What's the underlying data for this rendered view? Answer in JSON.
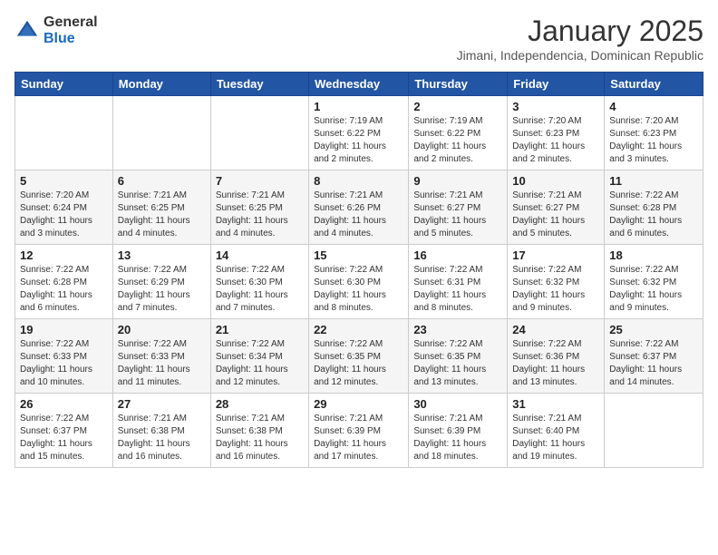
{
  "logo": {
    "general": "General",
    "blue": "Blue"
  },
  "header": {
    "month": "January 2025",
    "location": "Jimani, Independencia, Dominican Republic"
  },
  "weekdays": [
    "Sunday",
    "Monday",
    "Tuesday",
    "Wednesday",
    "Thursday",
    "Friday",
    "Saturday"
  ],
  "weeks": [
    [
      {
        "day": "",
        "sunrise": "",
        "sunset": "",
        "daylight": ""
      },
      {
        "day": "",
        "sunrise": "",
        "sunset": "",
        "daylight": ""
      },
      {
        "day": "",
        "sunrise": "",
        "sunset": "",
        "daylight": ""
      },
      {
        "day": "1",
        "sunrise": "7:19 AM",
        "sunset": "6:22 PM",
        "daylight": "11 hours and 2 minutes."
      },
      {
        "day": "2",
        "sunrise": "7:19 AM",
        "sunset": "6:22 PM",
        "daylight": "11 hours and 2 minutes."
      },
      {
        "day": "3",
        "sunrise": "7:20 AM",
        "sunset": "6:23 PM",
        "daylight": "11 hours and 2 minutes."
      },
      {
        "day": "4",
        "sunrise": "7:20 AM",
        "sunset": "6:23 PM",
        "daylight": "11 hours and 3 minutes."
      }
    ],
    [
      {
        "day": "5",
        "sunrise": "7:20 AM",
        "sunset": "6:24 PM",
        "daylight": "11 hours and 3 minutes."
      },
      {
        "day": "6",
        "sunrise": "7:21 AM",
        "sunset": "6:25 PM",
        "daylight": "11 hours and 4 minutes."
      },
      {
        "day": "7",
        "sunrise": "7:21 AM",
        "sunset": "6:25 PM",
        "daylight": "11 hours and 4 minutes."
      },
      {
        "day": "8",
        "sunrise": "7:21 AM",
        "sunset": "6:26 PM",
        "daylight": "11 hours and 4 minutes."
      },
      {
        "day": "9",
        "sunrise": "7:21 AM",
        "sunset": "6:27 PM",
        "daylight": "11 hours and 5 minutes."
      },
      {
        "day": "10",
        "sunrise": "7:21 AM",
        "sunset": "6:27 PM",
        "daylight": "11 hours and 5 minutes."
      },
      {
        "day": "11",
        "sunrise": "7:22 AM",
        "sunset": "6:28 PM",
        "daylight": "11 hours and 6 minutes."
      }
    ],
    [
      {
        "day": "12",
        "sunrise": "7:22 AM",
        "sunset": "6:28 PM",
        "daylight": "11 hours and 6 minutes."
      },
      {
        "day": "13",
        "sunrise": "7:22 AM",
        "sunset": "6:29 PM",
        "daylight": "11 hours and 7 minutes."
      },
      {
        "day": "14",
        "sunrise": "7:22 AM",
        "sunset": "6:30 PM",
        "daylight": "11 hours and 7 minutes."
      },
      {
        "day": "15",
        "sunrise": "7:22 AM",
        "sunset": "6:30 PM",
        "daylight": "11 hours and 8 minutes."
      },
      {
        "day": "16",
        "sunrise": "7:22 AM",
        "sunset": "6:31 PM",
        "daylight": "11 hours and 8 minutes."
      },
      {
        "day": "17",
        "sunrise": "7:22 AM",
        "sunset": "6:32 PM",
        "daylight": "11 hours and 9 minutes."
      },
      {
        "day": "18",
        "sunrise": "7:22 AM",
        "sunset": "6:32 PM",
        "daylight": "11 hours and 9 minutes."
      }
    ],
    [
      {
        "day": "19",
        "sunrise": "7:22 AM",
        "sunset": "6:33 PM",
        "daylight": "11 hours and 10 minutes."
      },
      {
        "day": "20",
        "sunrise": "7:22 AM",
        "sunset": "6:33 PM",
        "daylight": "11 hours and 11 minutes."
      },
      {
        "day": "21",
        "sunrise": "7:22 AM",
        "sunset": "6:34 PM",
        "daylight": "11 hours and 12 minutes."
      },
      {
        "day": "22",
        "sunrise": "7:22 AM",
        "sunset": "6:35 PM",
        "daylight": "11 hours and 12 minutes."
      },
      {
        "day": "23",
        "sunrise": "7:22 AM",
        "sunset": "6:35 PM",
        "daylight": "11 hours and 13 minutes."
      },
      {
        "day": "24",
        "sunrise": "7:22 AM",
        "sunset": "6:36 PM",
        "daylight": "11 hours and 13 minutes."
      },
      {
        "day": "25",
        "sunrise": "7:22 AM",
        "sunset": "6:37 PM",
        "daylight": "11 hours and 14 minutes."
      }
    ],
    [
      {
        "day": "26",
        "sunrise": "7:22 AM",
        "sunset": "6:37 PM",
        "daylight": "11 hours and 15 minutes."
      },
      {
        "day": "27",
        "sunrise": "7:21 AM",
        "sunset": "6:38 PM",
        "daylight": "11 hours and 16 minutes."
      },
      {
        "day": "28",
        "sunrise": "7:21 AM",
        "sunset": "6:38 PM",
        "daylight": "11 hours and 16 minutes."
      },
      {
        "day": "29",
        "sunrise": "7:21 AM",
        "sunset": "6:39 PM",
        "daylight": "11 hours and 17 minutes."
      },
      {
        "day": "30",
        "sunrise": "7:21 AM",
        "sunset": "6:39 PM",
        "daylight": "11 hours and 18 minutes."
      },
      {
        "day": "31",
        "sunrise": "7:21 AM",
        "sunset": "6:40 PM",
        "daylight": "11 hours and 19 minutes."
      },
      {
        "day": "",
        "sunrise": "",
        "sunset": "",
        "daylight": ""
      }
    ]
  ]
}
